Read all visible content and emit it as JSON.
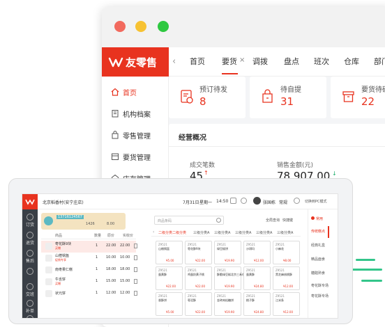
{
  "back_window": {
    "logo_text": "友零售",
    "tabs": [
      "首页",
      "要货",
      "调拨",
      "盘点",
      "班次",
      "仓库",
      "部门"
    ],
    "tab_close_icon": "×",
    "sidebar": [
      "首页",
      "机构档案",
      "零售管理",
      "要货管理",
      "店存管理"
    ],
    "stats": [
      {
        "label": "预订待发",
        "value": "8"
      },
      {
        "label": "待自提",
        "value": "31"
      },
      {
        "label": "要货待确认",
        "value": "22"
      }
    ],
    "overview_title": "经营概况",
    "metrics": [
      {
        "label": "成交笔数",
        "value": "45",
        "trend": "↑"
      },
      {
        "label": "销售金额(元)",
        "value": "78,907.00",
        "trend": "↓"
      }
    ],
    "accent_color": "#e8331f"
  },
  "pos": {
    "store_name": "北京稻香村(安宁庄店)",
    "date": "7月31日",
    "weekday": "星期一",
    "time": "14:50",
    "user": "张国栋",
    "shift": "常规",
    "switch_mode": "切换到PC模式",
    "left_nav": [
      "订货",
      "退货",
      "售后",
      "",
      "交班",
      "补单",
      "更多"
    ],
    "member": {
      "phone": "13716124567",
      "points": "1426",
      "balance": "8.00"
    },
    "cart_headers": [
      "商品",
      "数量",
      "原价",
      "实收价"
    ],
    "cart": [
      {
        "name": "枣花酥9块",
        "tag": "买赠",
        "qty": "1",
        "price": "22.00",
        "paid": "22.00"
      },
      {
        "name": "山楂锅盔",
        "tag": "促销专享",
        "qty": "1",
        "price": "10.00",
        "paid": "10.00"
      },
      {
        "name": "南枣果仁糕",
        "tag": "",
        "qty": "1",
        "price": "18.00",
        "paid": "18.00"
      },
      {
        "name": "牛舌饼",
        "tag": "买赠",
        "qty": "1",
        "price": "15.00",
        "paid": "15.00"
      },
      {
        "name": "状元饼",
        "tag": "",
        "qty": "1",
        "price": "12.00",
        "paid": "12.00"
      }
    ],
    "search_placeholder": "商品条码",
    "search_links": [
      "全局查询",
      "快捷键"
    ],
    "subcats": [
      "二级分类二级分类",
      "三级分类A",
      "三级分类A",
      "三级分类A",
      "三级分类A",
      "三级分类A"
    ],
    "products": [
      [
        {
          "code": "Z9521",
          "name": "山楂锅盔",
          "price": "¥5.00"
        },
        {
          "code": "Z9521",
          "name": "枣花酥9块",
          "price": "¥22.00"
        },
        {
          "code": "Z9521",
          "name": "绿豆糕饼",
          "price": "¥19.90"
        },
        {
          "code": "Z9521",
          "name": "沙琪玛",
          "price": "¥12.00"
        },
        {
          "code": "Z9521",
          "name": "小麻花",
          "price": "¥8.00"
        }
      ],
      [
        {
          "code": "Z9521",
          "name": "蛋黄酥",
          "price": "¥22.00"
        },
        {
          "code": "Z9521",
          "name": "鸡蛋奶黄子桃",
          "price": "¥22.00"
        },
        {
          "code": "Z9521",
          "name": "酥脆绿豆糕北京三禾杂",
          "price": "¥19.90"
        },
        {
          "code": "Z9521",
          "name": "蛋黄酥",
          "price": "¥24.80"
        },
        {
          "code": "Z9521",
          "name": "黑芝麻核桃酥",
          "price": "¥12.00"
        }
      ],
      [
        {
          "code": "Z9521",
          "name": "香酥饼",
          "price": "¥5.00"
        },
        {
          "code": "Z9521",
          "name": "枣泥酥",
          "price": "¥22.00"
        },
        {
          "code": "Z9521",
          "name": "金砖肉松糖饼",
          "price": "¥19.90"
        },
        {
          "code": "Z9521",
          "name": "桃子酥",
          "price": "¥24.80"
        },
        {
          "code": "Z9521",
          "name": "江米条",
          "price": "¥12.00"
        }
      ],
      [
        {
          "code": "Z9521",
          "name": "",
          "price": ""
        },
        {
          "code": "Z9521",
          "name": "",
          "price": ""
        },
        {
          "code": "Z9521",
          "name": "",
          "price": ""
        },
        {
          "code": "Z9521",
          "name": "",
          "price": ""
        },
        {
          "code": "Z9521",
          "name": "",
          "price": ""
        }
      ]
    ],
    "categories": [
      "常用",
      "传统糕点",
      "经典礼盒",
      "精品面食",
      "糖醋熟食",
      "枣花酥专场",
      "枣花酥专场"
    ]
  }
}
